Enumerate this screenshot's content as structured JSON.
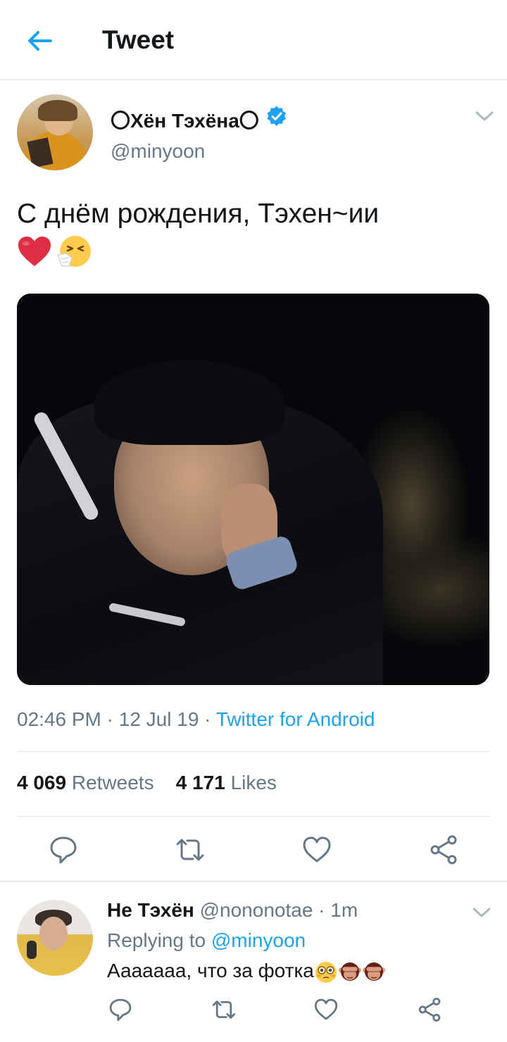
{
  "header": {
    "title": "Tweet",
    "back_icon": "arrow-left-icon",
    "accent": "#1da1f2"
  },
  "tweet": {
    "author_name": "〇Хён Тэхёна〇",
    "handle": "@minyoon",
    "verified": true,
    "text": "С днём рождения, Тэхен~ии",
    "emojis": [
      "red-heart-emoji",
      "sneezing-face-emoji"
    ],
    "time": "02:46 PM",
    "date": "12 Jul 19",
    "source": "Twitter for Android",
    "retweets_count": "4 069",
    "retweets_label": "Retweets",
    "likes_count": "4 171",
    "likes_label": "Likes",
    "actions": [
      "reply-icon",
      "retweet-icon",
      "like-icon",
      "share-icon"
    ]
  },
  "reply": {
    "author_name": "Не Тэхён",
    "handle": "@nononotae",
    "time": "1m",
    "replying_label": "Replying to",
    "replying_to": "@minyoon",
    "text": "Ааааааа, что за фотка",
    "emojis": [
      "flushed-face-emoji",
      "see-no-evil-monkey-emoji",
      "see-no-evil-monkey-emoji"
    ],
    "actions": [
      "reply-icon",
      "retweet-icon",
      "like-icon",
      "share-icon"
    ]
  },
  "colors": {
    "text": "#14171a",
    "secondary": "#657786",
    "link": "#1da1f2",
    "divider": "#e1e8ed"
  }
}
